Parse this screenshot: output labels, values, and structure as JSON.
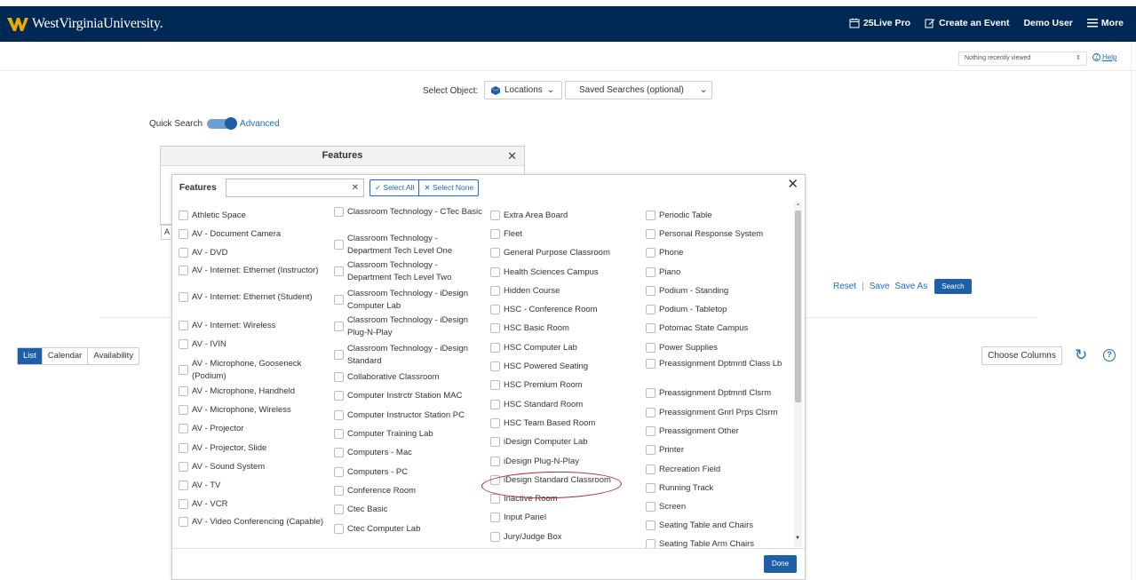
{
  "header": {
    "logo_text": "WestVirginiaUniversity.",
    "nav": {
      "pro": "25Live Pro",
      "create_event": "Create an Event",
      "user": "Demo User",
      "more": "More"
    }
  },
  "subbar": {
    "recent_select": "Nothing recently viewed",
    "help": "Help"
  },
  "search": {
    "select_object_label": "Select Object:",
    "object_value": "Locations",
    "saved_searches": "Saved Searches (optional)",
    "quick_search": "Quick Search",
    "advanced": "Advanced"
  },
  "back_panel": {
    "title": "Features",
    "stub_letter": "A"
  },
  "actions": {
    "reset": "Reset",
    "save": "Save",
    "save_as": "Save As",
    "search": "Search"
  },
  "results": {
    "tabs": [
      "List",
      "Calendar",
      "Availability"
    ],
    "choose_columns": "Choose Columns"
  },
  "modal": {
    "title": "Features",
    "search_value": "",
    "select_all": "Select All",
    "select_none": "Select None",
    "done": "Done",
    "columns": [
      [
        "Athletic Space",
        "AV - Document Camera",
        "AV - DVD",
        "AV - Internet: Ethernet (Instructor)",
        "AV - Internet: Ethernet (Student)",
        "AV - Internet: Wireless",
        "AV - IVIN",
        "AV - Microphone, Gooseneck (Podium)",
        "AV - Microphone, Handheld",
        "AV - Microphone, Wireless",
        "AV - Projector",
        "AV - Projector, Slide",
        "AV - Sound System",
        "AV - TV",
        "AV - VCR",
        "AV - Video Conferencing (Capable)"
      ],
      [
        "Classroom Technology - CTec Basic",
        "Classroom Technology - Department Tech Level One",
        "Classroom Technology - Department Tech Level Two",
        "Classroom Technology - iDesign Computer Lab",
        "Classroom Technology - iDesign Plug-N-Play",
        "Classroom Technology - iDesign Standard",
        "Collaborative Classroom",
        "Computer Instrctr Station MAC",
        "Computer Instructor Station PC",
        "Computer Training Lab",
        "Computers - Mac",
        "Computers - PC",
        "Conference Room",
        "Ctec Basic",
        "Ctec Computer Lab"
      ],
      [
        "Extra Area Board",
        "Fleet",
        "General Purpose Classroom",
        "Health Sciences Campus",
        "Hidden Course",
        "HSC - Conference Room",
        "HSC Basic Room",
        "HSC Computer Lab",
        "HSC Powered Seating",
        "HSC Premium Room",
        "HSC Standard Room",
        "HSC Team Based Room",
        "iDesign Computer Lab",
        "iDesign Plug-N-Play",
        "iDesign Standard Classroom",
        "Inactive Room",
        "Input Panel",
        "Jury/Judge Box"
      ],
      [
        "Periodic Table",
        "Personal Response System",
        "Phone",
        "Piano",
        "Podium - Standing",
        "Podium - Tabletop",
        "Potomac State Campus",
        "Power Supplies",
        "Preassignment Dptmntl Class Lb",
        "Preassignment Dptmntl Clsrm",
        "Preassignment Gnrl Prps Clsrm",
        "Preassignment Other",
        "Printer",
        "Recreation Field",
        "Running Track",
        "Screen",
        "Seating Table and Chairs",
        "Seating Table Arm Chairs"
      ]
    ]
  }
}
